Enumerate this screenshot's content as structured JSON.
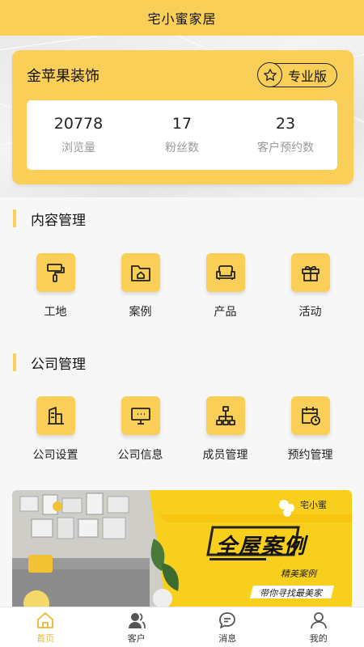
{
  "header": {
    "title": "宅小蜜家居"
  },
  "shop": {
    "name": "金苹果装饰",
    "badge": "专业版",
    "stats": [
      {
        "value": "20778",
        "label": "浏览量"
      },
      {
        "value": "17",
        "label": "粉丝数"
      },
      {
        "value": "23",
        "label": "客户预约数"
      }
    ]
  },
  "content_section": {
    "title": "内容管理",
    "items": [
      {
        "label": "工地",
        "icon": "paint-roller-icon"
      },
      {
        "label": "案例",
        "icon": "folder-home-icon"
      },
      {
        "label": "产品",
        "icon": "sofa-icon"
      },
      {
        "label": "活动",
        "icon": "gift-icon"
      }
    ]
  },
  "company_section": {
    "title": "公司管理",
    "items": [
      {
        "label": "公司设置",
        "icon": "building-icon"
      },
      {
        "label": "公司信息",
        "icon": "monitor-icon"
      },
      {
        "label": "成员管理",
        "icon": "org-chart-icon"
      },
      {
        "label": "预约管理",
        "icon": "calendar-clock-icon"
      }
    ]
  },
  "banner": {
    "brand": "宅小蜜",
    "headline": "全屋案例",
    "tag1": "精美案例",
    "tag2": "带你寻找最美家"
  },
  "tabbar": {
    "items": [
      {
        "label": "首页",
        "icon": "home-icon",
        "active": true
      },
      {
        "label": "客户",
        "icon": "customer-icon",
        "active": false
      },
      {
        "label": "消息",
        "icon": "message-icon",
        "active": false
      },
      {
        "label": "我的",
        "icon": "profile-icon",
        "active": false
      }
    ]
  },
  "colors": {
    "accent": "#f9cf58",
    "active_tab": "#e8b93a"
  }
}
